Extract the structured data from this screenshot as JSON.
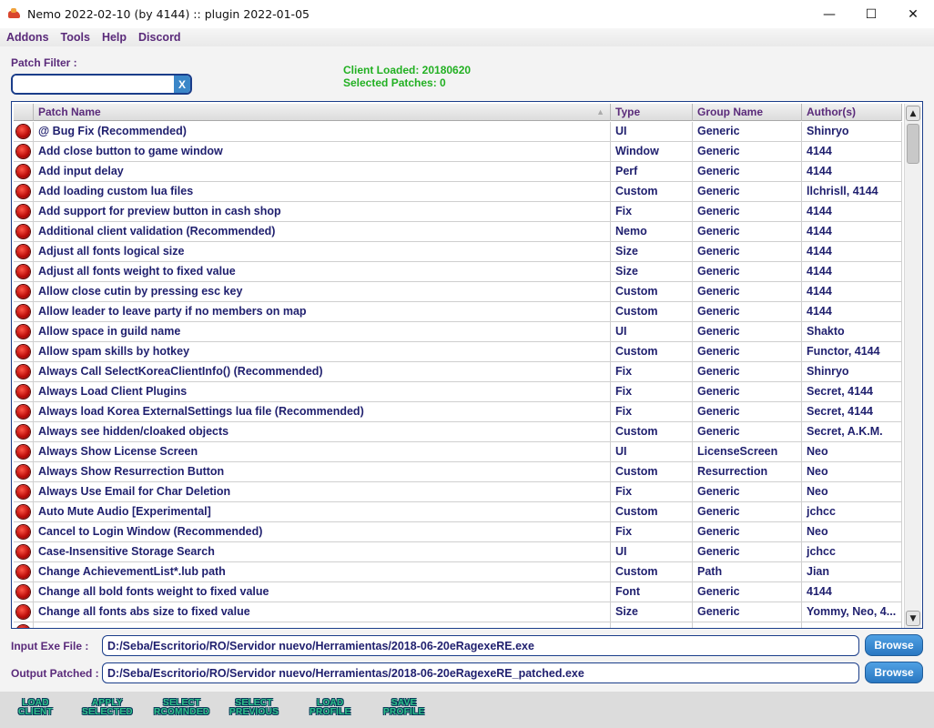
{
  "window": {
    "title": "Nemo 2022-02-10 (by 4144) :: plugin 2022-01-05",
    "minimize_glyph": "—",
    "maximize_glyph": "☐",
    "close_glyph": "✕"
  },
  "menu": [
    "Addons",
    "Tools",
    "Help",
    "Discord"
  ],
  "filter": {
    "label": "Patch Filter :",
    "value": "",
    "clear_label": "X"
  },
  "status": {
    "client_loaded": "Client Loaded: 20180620",
    "selected_patches": "Selected Patches: 0"
  },
  "table": {
    "columns": [
      "Patch Name",
      "Type",
      "Group Name",
      "Author(s)"
    ],
    "rows": [
      {
        "name": "@ Bug Fix (Recommended)",
        "type": "UI",
        "group": "Generic",
        "author": "Shinryo"
      },
      {
        "name": "Add close button to game window",
        "type": "Window",
        "group": "Generic",
        "author": "4144"
      },
      {
        "name": "Add input delay",
        "type": "Perf",
        "group": "Generic",
        "author": "4144"
      },
      {
        "name": "Add loading custom lua files",
        "type": "Custom",
        "group": "Generic",
        "author": "llchrisll, 4144"
      },
      {
        "name": "Add support for preview button in cash shop",
        "type": "Fix",
        "group": "Generic",
        "author": "4144"
      },
      {
        "name": "Additional client validation (Recommended)",
        "type": "Nemo",
        "group": "Generic",
        "author": "4144"
      },
      {
        "name": "Adjust all fonts logical size",
        "type": "Size",
        "group": "Generic",
        "author": "4144"
      },
      {
        "name": "Adjust all fonts weight to fixed value",
        "type": "Size",
        "group": "Generic",
        "author": "4144"
      },
      {
        "name": "Allow close cutin by pressing esc key",
        "type": "Custom",
        "group": "Generic",
        "author": "4144"
      },
      {
        "name": "Allow leader to leave party if no members on map",
        "type": "Custom",
        "group": "Generic",
        "author": "4144"
      },
      {
        "name": "Allow space in guild name",
        "type": "UI",
        "group": "Generic",
        "author": "Shakto"
      },
      {
        "name": "Allow spam skills by hotkey",
        "type": "Custom",
        "group": "Generic",
        "author": "Functor, 4144"
      },
      {
        "name": "Always Call SelectKoreaClientInfo() (Recommended)",
        "type": "Fix",
        "group": "Generic",
        "author": "Shinryo"
      },
      {
        "name": "Always Load Client Plugins",
        "type": "Fix",
        "group": "Generic",
        "author": "Secret, 4144"
      },
      {
        "name": "Always load Korea ExternalSettings lua file (Recommended)",
        "type": "Fix",
        "group": "Generic",
        "author": "Secret, 4144"
      },
      {
        "name": "Always see hidden/cloaked objects",
        "type": "Custom",
        "group": "Generic",
        "author": "Secret, A.K.M."
      },
      {
        "name": "Always Show License Screen",
        "type": "UI",
        "group": "LicenseScreen",
        "author": "Neo"
      },
      {
        "name": "Always Show Resurrection Button",
        "type": "Custom",
        "group": "Resurrection",
        "author": "Neo"
      },
      {
        "name": "Always Use Email for Char Deletion",
        "type": "Fix",
        "group": "Generic",
        "author": "Neo"
      },
      {
        "name": "Auto Mute Audio [Experimental]",
        "type": "Custom",
        "group": "Generic",
        "author": "jchcc"
      },
      {
        "name": "Cancel to Login Window (Recommended)",
        "type": "Fix",
        "group": "Generic",
        "author": "Neo"
      },
      {
        "name": "Case-Insensitive Storage Search",
        "type": "UI",
        "group": "Generic",
        "author": "jchcc"
      },
      {
        "name": "Change AchievementList*.lub path",
        "type": "Custom",
        "group": "Path",
        "author": "Jian"
      },
      {
        "name": "Change all bold fonts weight to fixed value",
        "type": "Font",
        "group": "Generic",
        "author": "4144"
      },
      {
        "name": "Change all fonts abs size to fixed value",
        "type": "Size",
        "group": "Generic",
        "author": "Yommy, Neo, 4..."
      },
      {
        "name": "",
        "type": "",
        "group": "",
        "author": ""
      }
    ]
  },
  "files": {
    "input_label": "Input Exe File   :",
    "input_value": "D:/Seba/Escritorio/RO/Servidor nuevo/Herramientas/2018-06-20eRagexeRE.exe",
    "output_label": "Output Patched :",
    "output_value": "D:/Seba/Escritorio/RO/Servidor nuevo/Herramientas/2018-06-20eRagexeRE_patched.exe",
    "browse_label": "Browse"
  },
  "actions": [
    {
      "line1": "LOAD",
      "line2": "CLIENT"
    },
    {
      "line1": "APPLY",
      "line2": "SELECTED"
    },
    {
      "line1": "SELECT",
      "line2": "RCOMNDED"
    },
    {
      "line1": "SELECT",
      "line2": "PREVIOUS"
    },
    {
      "line1": "LOAD",
      "line2": "PROFILE"
    },
    {
      "line1": "SAVE",
      "line2": "PROFILE"
    }
  ],
  "colors": {
    "accent_purple": "#5a2a7a",
    "row_text": "#1f1f6e",
    "status_green": "#22b022",
    "browse_blue": "#2a78c2"
  },
  "icons": {
    "patch_state": "red-dot-icon",
    "sort": "sort-arrow-icon",
    "scroll_up": "scroll-up-arrow-icon",
    "scroll_down": "scroll-down-arrow-icon"
  }
}
